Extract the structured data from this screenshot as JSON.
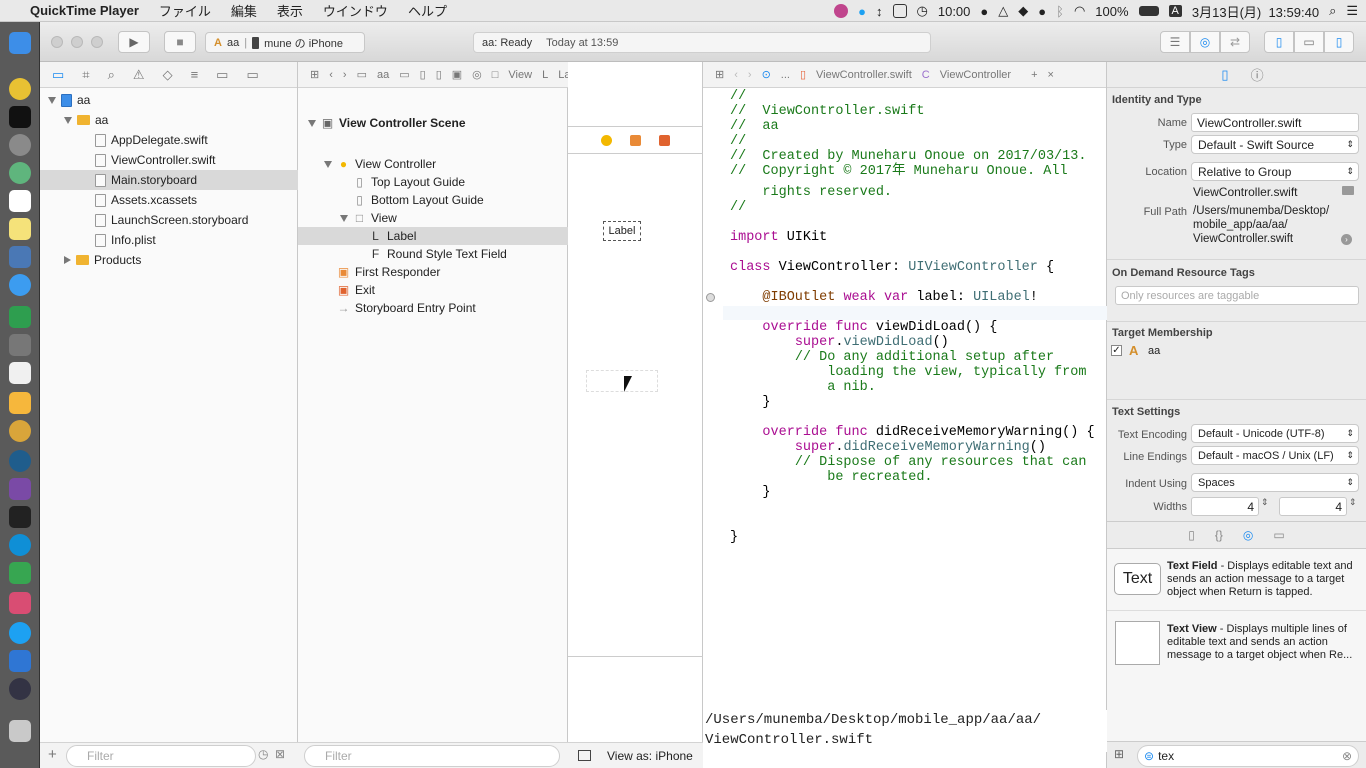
{
  "menubar": {
    "app": "QuickTime Player",
    "menus": [
      "ファイル",
      "編集",
      "表示",
      "ウインドウ",
      "ヘルプ"
    ],
    "clock_small": "10:00",
    "battery": "100%",
    "input_method": "A",
    "date_time": "3月13日(月)  13:59:40"
  },
  "toolbar": {
    "scheme": "aa",
    "device": "mune の iPhone",
    "status_project": "aa: Ready",
    "status_time": "Today at 13:59"
  },
  "navigator": {
    "items": [
      {
        "label": "aa",
        "kind": "project",
        "indent": 0,
        "open": true
      },
      {
        "label": "aa",
        "kind": "folder",
        "indent": 1,
        "open": true
      },
      {
        "label": "AppDelegate.swift",
        "kind": "file",
        "indent": 2
      },
      {
        "label": "ViewController.swift",
        "kind": "file",
        "indent": 2
      },
      {
        "label": "Main.storyboard",
        "kind": "file",
        "indent": 2,
        "selected": true
      },
      {
        "label": "Assets.xcassets",
        "kind": "file",
        "indent": 2
      },
      {
        "label": "LaunchScreen.storyboard",
        "kind": "file",
        "indent": 2
      },
      {
        "label": "Info.plist",
        "kind": "file",
        "indent": 2
      },
      {
        "label": "Products",
        "kind": "folder",
        "indent": 1,
        "open": false
      }
    ],
    "filter_placeholder": "Filter"
  },
  "outline": {
    "breadcrumb": [
      "aa",
      "View",
      "Label"
    ],
    "items": [
      {
        "label": "View Controller Scene",
        "indent": 0,
        "bold": true
      },
      {
        "label": "View Controller",
        "indent": 1
      },
      {
        "label": "Top Layout Guide",
        "indent": 2
      },
      {
        "label": "Bottom Layout Guide",
        "indent": 2
      },
      {
        "label": "View",
        "indent": 2
      },
      {
        "label": "Label",
        "indent": 3,
        "selected": true
      },
      {
        "label": "Round Style Text Field",
        "indent": 3
      },
      {
        "label": "First Responder",
        "indent": 1
      },
      {
        "label": "Exit",
        "indent": 1
      },
      {
        "label": "Storyboard Entry Point",
        "indent": 1
      }
    ],
    "filter_placeholder": "Filter"
  },
  "canvas": {
    "label_text": "Label",
    "view_as": "View as: iPhone"
  },
  "editor": {
    "breadcrumb": [
      "...",
      "ViewController.swift",
      "ViewController"
    ],
    "lines": [
      [
        [
          "cm",
          "//"
        ]
      ],
      [
        [
          "cm",
          "//  ViewController.swift"
        ]
      ],
      [
        [
          "cm",
          "//  aa"
        ]
      ],
      [
        [
          "cm",
          "//"
        ]
      ],
      [
        [
          "cm",
          "//  Created by Muneharu Onoue on 2017/03/13."
        ]
      ],
      [
        [
          "cm",
          "//  Copyright © 2017年 Muneharu Onoue. All"
        ]
      ],
      [
        [
          "cm",
          "    rights reserved."
        ]
      ],
      [
        [
          "cm",
          "//"
        ]
      ],
      [
        [
          "pl",
          ""
        ]
      ],
      [
        [
          "kw",
          "import"
        ],
        [
          "pl",
          " UIKit"
        ]
      ],
      [
        [
          "pl",
          ""
        ]
      ],
      [
        [
          "kw",
          "class"
        ],
        [
          "pl",
          " ViewController: "
        ],
        [
          "ty",
          "UIViewController"
        ],
        [
          "pl",
          " {"
        ]
      ],
      [
        [
          "pl",
          ""
        ]
      ],
      [
        [
          "pl",
          "    "
        ],
        [
          "at",
          "@IBOutlet"
        ],
        [
          "pl",
          " "
        ],
        [
          "kw",
          "weak var"
        ],
        [
          "pl",
          " label: "
        ],
        [
          "ty",
          "UILabel"
        ],
        [
          "pl",
          "!"
        ]
      ],
      [
        [
          "pl",
          ""
        ]
      ],
      [
        [
          "pl",
          "    "
        ],
        [
          "kw",
          "override func"
        ],
        [
          "pl",
          " viewDidLoad() {"
        ]
      ],
      [
        [
          "pl",
          "        "
        ],
        [
          "kw",
          "super"
        ],
        [
          "pl",
          "."
        ],
        [
          "ty",
          "viewDidLoad"
        ],
        [
          "pl",
          "()"
        ]
      ],
      [
        [
          "pl",
          "        "
        ],
        [
          "cm",
          "// Do any additional setup after"
        ]
      ],
      [
        [
          "cm",
          "            loading the view, typically from"
        ]
      ],
      [
        [
          "cm",
          "            a nib."
        ]
      ],
      [
        [
          "pl",
          "    }"
        ]
      ],
      [
        [
          "pl",
          ""
        ]
      ],
      [
        [
          "pl",
          "    "
        ],
        [
          "kw",
          "override func"
        ],
        [
          "pl",
          " didReceiveMemoryWarning() {"
        ]
      ],
      [
        [
          "pl",
          "        "
        ],
        [
          "kw",
          "super"
        ],
        [
          "pl",
          "."
        ],
        [
          "ty",
          "didReceiveMemoryWarning"
        ],
        [
          "pl",
          "()"
        ]
      ],
      [
        [
          "pl",
          "        "
        ],
        [
          "cm",
          "// Dispose of any resources that can"
        ]
      ],
      [
        [
          "cm",
          "            be recreated."
        ]
      ],
      [
        [
          "pl",
          "    }"
        ]
      ],
      [
        [
          "pl",
          ""
        ]
      ],
      [
        [
          "pl",
          ""
        ]
      ],
      [
        [
          "pl",
          "}"
        ]
      ]
    ],
    "path_popup_1": "/Users/munemba/Desktop/mobile_app/aa/aa/",
    "path_popup_2": "ViewController.swift"
  },
  "inspector": {
    "identity_header": "Identity and Type",
    "name_label": "Name",
    "name_value": "ViewController.swift",
    "type_label": "Type",
    "type_value": "Default - Swift Source",
    "location_label": "Location",
    "location_value": "Relative to Group",
    "location_file": "ViewController.swift",
    "fullpath_label": "Full Path",
    "fullpath_lines": [
      "/Users/munemba/Desktop/",
      "mobile_app/aa/aa/",
      "ViewController.swift"
    ],
    "odr_header": "On Demand Resource Tags",
    "odr_placeholder": "Only resources are taggable",
    "target_header": "Target Membership",
    "target_name": "aa",
    "text_settings_header": "Text Settings",
    "encoding_label": "Text Encoding",
    "encoding_value": "Default - Unicode (UTF-8)",
    "endings_label": "Line Endings",
    "endings_value": "Default - macOS / Unix (LF)",
    "indent_label": "Indent Using",
    "indent_value": "Spaces",
    "widths_label": "Widths",
    "tab_value": "4",
    "indent_width_value": "4"
  },
  "library": {
    "items": [
      {
        "icon_text": "Text",
        "title": "Text Field",
        "desc": " - Displays editable text and sends an action message to a target object when Return is tapped."
      },
      {
        "icon_text": "",
        "title": "Text View",
        "desc": " - Displays multiple lines of editable text and sends an action message to a target object when Re..."
      }
    ],
    "search_value": "tex"
  },
  "colors": {
    "selection": "#d9d9d9",
    "accent": "#1b8af0",
    "folder": "#f0b330"
  }
}
